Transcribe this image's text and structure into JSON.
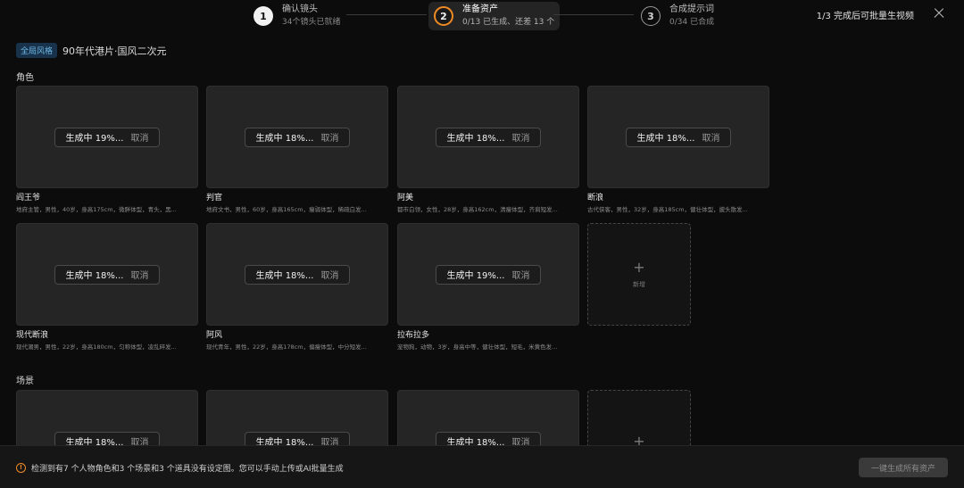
{
  "steps": [
    {
      "num": "1",
      "title": "确认镜头",
      "sub": "34个镜头已就绪"
    },
    {
      "num": "2",
      "title": "准备资产",
      "sub": "0/13 已生成、还差 13 个"
    },
    {
      "num": "3",
      "title": "合成提示词",
      "sub": "0/34 已合成"
    }
  ],
  "header": {
    "progress_note": "1/3 完成后可批量生视频"
  },
  "global_style": {
    "badge": "全局风格",
    "value": "90年代港片·国风二次元"
  },
  "sections": {
    "characters": "角色",
    "scenes": "场景"
  },
  "cancel_label": "取消",
  "characters": [
    {
      "status": "生成中 19%...",
      "name": "阎王爷",
      "desc": "地府主管，男性，40岁，身高175cm，微胖体型，青头，黑..."
    },
    {
      "status": "生成中 18%...",
      "name": "判官",
      "desc": "地府文书，男性，60岁，身高165cm，瘦弱体型，稀疏白发..."
    },
    {
      "status": "生成中 18%...",
      "name": "阿美",
      "desc": "都市白领，女性，28岁，身高162cm，清瘦体型，齐肩短发..."
    },
    {
      "status": "生成中 18%...",
      "name": "断浪",
      "desc": "古代侠客，男性，32岁，身高185cm，健壮体型，披头散发..."
    },
    {
      "status": "生成中 18%...",
      "name": "现代断浪",
      "desc": "现代潮男，男性，22岁，身高180cm，匀称体型，凌乱碎发..."
    },
    {
      "status": "生成中 18%...",
      "name": "阿风",
      "desc": "现代青年，男性，22岁，身高178cm，偏瘦体型，中分短发..."
    },
    {
      "status": "生成中 19%...",
      "name": "拉布拉多",
      "desc": "宠物狗，动物，3岁，身高中等，健壮体型，短毛，米黄色发..."
    }
  ],
  "add_label": "新增",
  "scenes": [
    {
      "status": "生成中 18%..."
    },
    {
      "status": "生成中 18%..."
    },
    {
      "status": "生成中 18%..."
    }
  ],
  "footer": {
    "warning": "检测到有7 个人物角色和3 个场景和3 个道具没有设定图。您可以手动上传或AI批量生成",
    "generate_all": "一键生成所有资产"
  }
}
